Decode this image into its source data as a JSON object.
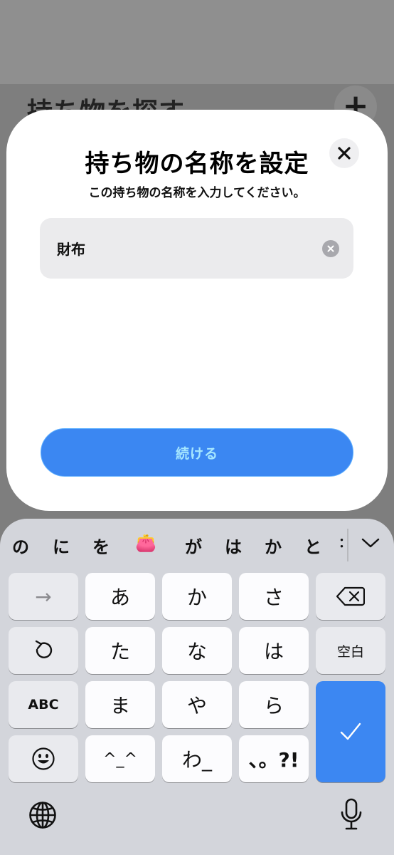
{
  "background": {
    "title": "持ち物を探す",
    "plus": "+"
  },
  "modal": {
    "title": "持ち物の名称を設定",
    "subtitle": "この持ち物の名称を入力してください。",
    "input_value": "財布",
    "continue_label": "続ける",
    "close_icon": "close-icon",
    "clear_icon": "clear-circle-icon"
  },
  "keyboard": {
    "suggestions": [
      "の",
      "に",
      "を",
      "👛",
      "が",
      "は",
      "か",
      "と",
      "："
    ],
    "rows": [
      [
        "→",
        "あ",
        "か",
        "さ",
        "⌫"
      ],
      [
        "↺",
        "た",
        "な",
        "は",
        "空白"
      ],
      [
        "ABC",
        "ま",
        "や",
        "ら"
      ],
      [
        "☺",
        "^_^",
        "わ_",
        "、。?!"
      ]
    ],
    "enter_label": "✓",
    "globe_icon": "globe-icon",
    "mic_icon": "microphone-icon"
  },
  "colors": {
    "accent": "#3b87f2",
    "continue_text": "#a5e6ff",
    "keyboard_bg": "#d3d5db"
  }
}
